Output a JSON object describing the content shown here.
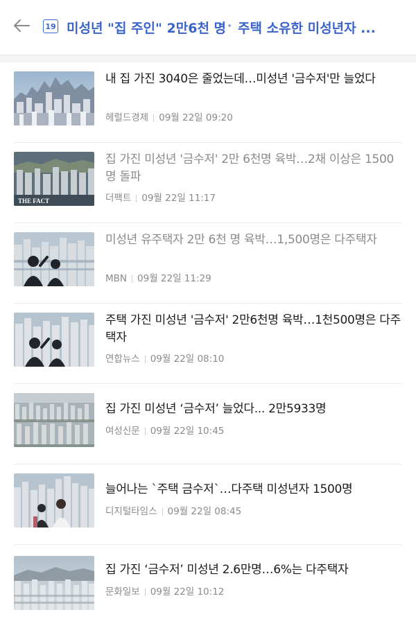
{
  "header": {
    "back_icon": "arrow-left-icon",
    "rank": "19",
    "topic": "미성년 \"집 주인\" 2만6천 명",
    "separator": "•",
    "subtopic": "주택 소유한 미성년자 ..."
  },
  "colors": {
    "accent": "#3b64c8",
    "read_text": "#8a8a8a",
    "unread_text": "#1a1a1a"
  },
  "articles": [
    {
      "title": "내 집 가진 3040은 줄었는데…미성년 '금수저'만 늘었다",
      "source": "헤럴드경제",
      "time": "09월 22일 09:20",
      "read": false
    },
    {
      "title": "집 가진 미성년 '금수저' 2만 6천명 육박…2채 이상은 1500명 돌파",
      "source": "더팩트",
      "time": "09월 22일 11:17",
      "read": true,
      "thumb_caption": "THE FACT"
    },
    {
      "title": "미성년 유주택자 2만 6천 명 육박…1,500명은 다주택자",
      "source": "MBN",
      "time": "09월 22일 11:29",
      "read": true
    },
    {
      "title": "주택 가진 미성년 '금수저' 2만6천명 육박…1천500명은 다주택자",
      "source": "연합뉴스",
      "time": "09월 22일 08:10",
      "read": false
    },
    {
      "title": "집 가진 미성년 ‘금수저’ 늘었다... 2만5933명",
      "source": "여성신문",
      "time": "09월 22일 10:45",
      "read": false
    },
    {
      "title": "늘어나는 `주택 금수저`…다주택 미성년자 1500명",
      "source": "디지털타임스",
      "time": "09월 22일 08:45",
      "read": false
    },
    {
      "title": "집 가진 ‘금수저’ 미성년 2.6만명…6%는 다주택자",
      "source": "문화일보",
      "time": "09월 22일 10:12",
      "read": false
    }
  ]
}
